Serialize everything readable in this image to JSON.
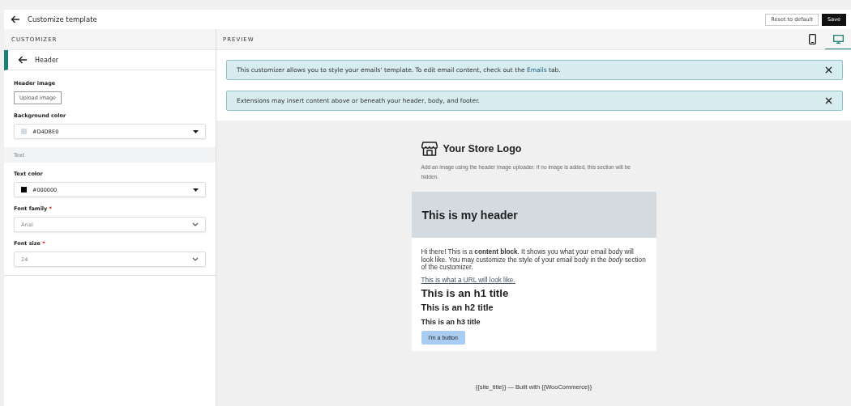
{
  "header": {
    "title": "Customize template",
    "buttons": [
      {
        "label": "Reset to default",
        "kind": "secondary"
      },
      {
        "label": "Save",
        "kind": "primary"
      }
    ]
  },
  "customizer": {
    "heading": "CUSTOMIZER",
    "section_title": "Header",
    "fields": [
      {
        "kind": "upload",
        "label": "Header image",
        "button": "Upload image"
      },
      {
        "kind": "color",
        "label": "Background color",
        "value": "#D4DBE0"
      },
      {
        "kind": "subheading",
        "label": "Text"
      },
      {
        "kind": "color",
        "label": "Text color",
        "value": "#000000"
      },
      {
        "kind": "select",
        "label": "Font family",
        "required_mark": "*",
        "value": "Arial"
      },
      {
        "kind": "select",
        "label": "Font size",
        "required_mark": "*",
        "value": "24"
      }
    ]
  },
  "preview": {
    "heading": "PREVIEW",
    "devices": [
      {
        "kind": "mobile",
        "selected": false
      },
      {
        "kind": "desktop",
        "selected": true
      }
    ],
    "notices": [
      {
        "text": "This customizer allows you to style your emails' template. To edit email content, check out the ",
        "link": "Emails",
        "after": " tab."
      },
      {
        "text": "Extensions may insert content above or beneath your header, body, and footer."
      }
    ],
    "email": {
      "logo_title": "Your Store Logo",
      "logo_hint": "Add an image using the header image uploader. If no image is added, this section will be hidden.",
      "header": "This is my header",
      "body": "Hi there! This is a **content block**. It shows you what your email body will look like. You may customize the style of your email body in the *body* section of the customizer.",
      "url": "This is what a URL will look like.",
      "h1": "This is an h1 title",
      "h2": "This is an h2 title",
      "h3": "This is an h3 title",
      "button": "I'm a button",
      "footer": "{{site_title}} — Built with {{WooCommerce}}"
    }
  }
}
